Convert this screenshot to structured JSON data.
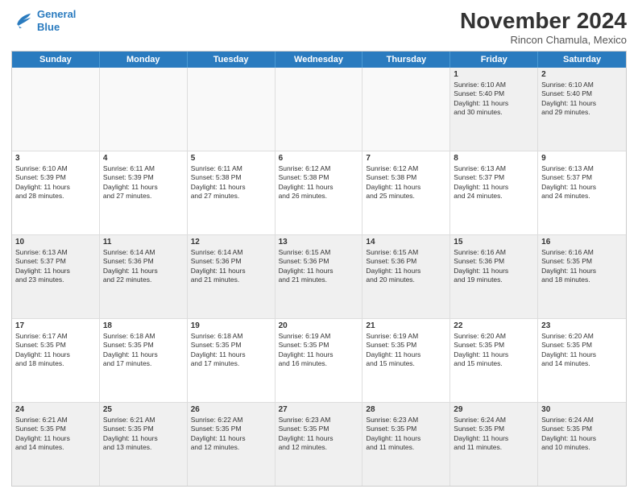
{
  "logo": {
    "line1": "General",
    "line2": "Blue"
  },
  "title": "November 2024",
  "subtitle": "Rincon Chamula, Mexico",
  "days": [
    "Sunday",
    "Monday",
    "Tuesday",
    "Wednesday",
    "Thursday",
    "Friday",
    "Saturday"
  ],
  "rows": [
    [
      {
        "day": "",
        "empty": true
      },
      {
        "day": "",
        "empty": true
      },
      {
        "day": "",
        "empty": true
      },
      {
        "day": "",
        "empty": true
      },
      {
        "day": "",
        "empty": true
      },
      {
        "day": "1",
        "info": "Sunrise: 6:10 AM\nSunset: 5:40 PM\nDaylight: 11 hours\nand 30 minutes."
      },
      {
        "day": "2",
        "info": "Sunrise: 6:10 AM\nSunset: 5:40 PM\nDaylight: 11 hours\nand 29 minutes."
      }
    ],
    [
      {
        "day": "3",
        "info": "Sunrise: 6:10 AM\nSunset: 5:39 PM\nDaylight: 11 hours\nand 28 minutes."
      },
      {
        "day": "4",
        "info": "Sunrise: 6:11 AM\nSunset: 5:39 PM\nDaylight: 11 hours\nand 27 minutes."
      },
      {
        "day": "5",
        "info": "Sunrise: 6:11 AM\nSunset: 5:38 PM\nDaylight: 11 hours\nand 27 minutes."
      },
      {
        "day": "6",
        "info": "Sunrise: 6:12 AM\nSunset: 5:38 PM\nDaylight: 11 hours\nand 26 minutes."
      },
      {
        "day": "7",
        "info": "Sunrise: 6:12 AM\nSunset: 5:38 PM\nDaylight: 11 hours\nand 25 minutes."
      },
      {
        "day": "8",
        "info": "Sunrise: 6:13 AM\nSunset: 5:37 PM\nDaylight: 11 hours\nand 24 minutes."
      },
      {
        "day": "9",
        "info": "Sunrise: 6:13 AM\nSunset: 5:37 PM\nDaylight: 11 hours\nand 24 minutes."
      }
    ],
    [
      {
        "day": "10",
        "info": "Sunrise: 6:13 AM\nSunset: 5:37 PM\nDaylight: 11 hours\nand 23 minutes."
      },
      {
        "day": "11",
        "info": "Sunrise: 6:14 AM\nSunset: 5:36 PM\nDaylight: 11 hours\nand 22 minutes."
      },
      {
        "day": "12",
        "info": "Sunrise: 6:14 AM\nSunset: 5:36 PM\nDaylight: 11 hours\nand 21 minutes."
      },
      {
        "day": "13",
        "info": "Sunrise: 6:15 AM\nSunset: 5:36 PM\nDaylight: 11 hours\nand 21 minutes."
      },
      {
        "day": "14",
        "info": "Sunrise: 6:15 AM\nSunset: 5:36 PM\nDaylight: 11 hours\nand 20 minutes."
      },
      {
        "day": "15",
        "info": "Sunrise: 6:16 AM\nSunset: 5:36 PM\nDaylight: 11 hours\nand 19 minutes."
      },
      {
        "day": "16",
        "info": "Sunrise: 6:16 AM\nSunset: 5:35 PM\nDaylight: 11 hours\nand 18 minutes."
      }
    ],
    [
      {
        "day": "17",
        "info": "Sunrise: 6:17 AM\nSunset: 5:35 PM\nDaylight: 11 hours\nand 18 minutes."
      },
      {
        "day": "18",
        "info": "Sunrise: 6:18 AM\nSunset: 5:35 PM\nDaylight: 11 hours\nand 17 minutes."
      },
      {
        "day": "19",
        "info": "Sunrise: 6:18 AM\nSunset: 5:35 PM\nDaylight: 11 hours\nand 17 minutes."
      },
      {
        "day": "20",
        "info": "Sunrise: 6:19 AM\nSunset: 5:35 PM\nDaylight: 11 hours\nand 16 minutes."
      },
      {
        "day": "21",
        "info": "Sunrise: 6:19 AM\nSunset: 5:35 PM\nDaylight: 11 hours\nand 15 minutes."
      },
      {
        "day": "22",
        "info": "Sunrise: 6:20 AM\nSunset: 5:35 PM\nDaylight: 11 hours\nand 15 minutes."
      },
      {
        "day": "23",
        "info": "Sunrise: 6:20 AM\nSunset: 5:35 PM\nDaylight: 11 hours\nand 14 minutes."
      }
    ],
    [
      {
        "day": "24",
        "info": "Sunrise: 6:21 AM\nSunset: 5:35 PM\nDaylight: 11 hours\nand 14 minutes."
      },
      {
        "day": "25",
        "info": "Sunrise: 6:21 AM\nSunset: 5:35 PM\nDaylight: 11 hours\nand 13 minutes."
      },
      {
        "day": "26",
        "info": "Sunrise: 6:22 AM\nSunset: 5:35 PM\nDaylight: 11 hours\nand 12 minutes."
      },
      {
        "day": "27",
        "info": "Sunrise: 6:23 AM\nSunset: 5:35 PM\nDaylight: 11 hours\nand 12 minutes."
      },
      {
        "day": "28",
        "info": "Sunrise: 6:23 AM\nSunset: 5:35 PM\nDaylight: 11 hours\nand 11 minutes."
      },
      {
        "day": "29",
        "info": "Sunrise: 6:24 AM\nSunset: 5:35 PM\nDaylight: 11 hours\nand 11 minutes."
      },
      {
        "day": "30",
        "info": "Sunrise: 6:24 AM\nSunset: 5:35 PM\nDaylight: 11 hours\nand 10 minutes."
      }
    ]
  ]
}
